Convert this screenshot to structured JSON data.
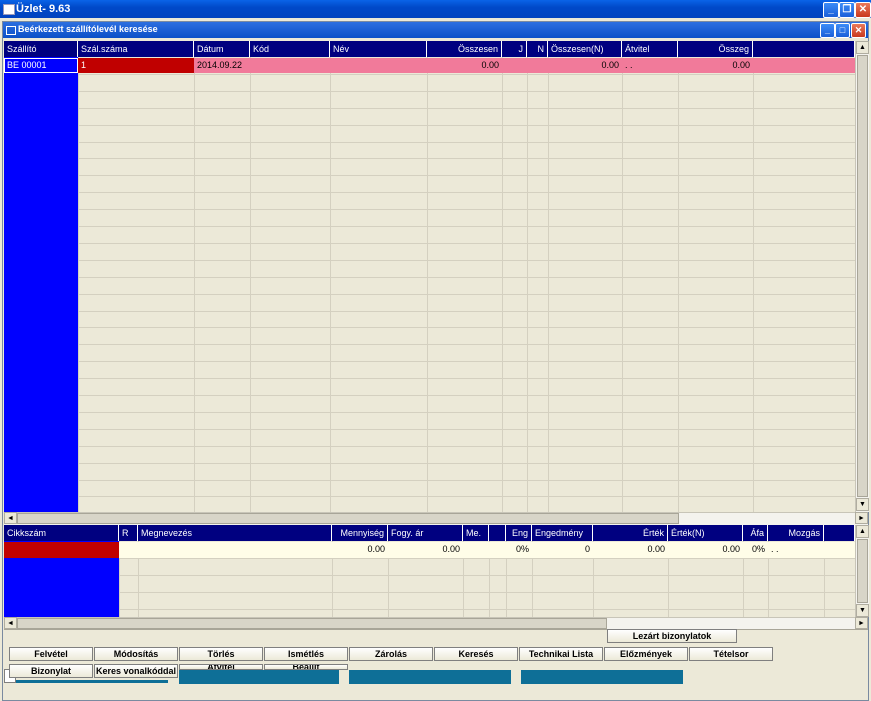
{
  "app": {
    "title": "Üzlet- 9.63"
  },
  "window": {
    "title": "Beérkezett szállítólevél keresése"
  },
  "top_grid": {
    "columns": [
      "Szállító",
      "Szál.száma",
      "Dátum",
      "Kód",
      "Név",
      "Összesen",
      "J",
      "N",
      "Összesen(N)",
      "Átvitel",
      "Összeg"
    ],
    "row": {
      "szallito": "BE  00001",
      "szal_szama": "1",
      "datum": "2014.09.22",
      "osszesen": "0.00",
      "osszesen_n": "0.00",
      "atvitel": ". .",
      "osszeg": "0.00"
    },
    "colors": {
      "selected_row": "#F17A9A",
      "selected_cell": "#C00000",
      "row_marker": "#0000FF",
      "header": "#000080"
    }
  },
  "bottom_grid": {
    "columns": [
      "Cikkszám",
      "R",
      "Megnevezés",
      "Mennyiség",
      "Fogy. ár",
      "Me.",
      "",
      "Eng",
      "Engedmény",
      "Érték",
      "Érték(N)",
      "Áfa",
      "Mozgás"
    ],
    "row": {
      "mennyiseg": "0.00",
      "fogy_ar": "0.00",
      "eng": "0%",
      "engedmeny": "0",
      "ertek": "0.00",
      "ertek_n": "0.00",
      "afa": "0%",
      "mozgas": ". ."
    }
  },
  "buttons": {
    "lezart": "Lezárt bizonylatok",
    "row1": [
      "Felvétel",
      "Módosítás",
      "Törlés",
      "Ismétlés",
      "Zárolás",
      "Keresés",
      "Technikai Lista",
      "Előzmények",
      "Tételsor"
    ],
    "row2": [
      "Bizonylat",
      "Keres vonalkóddal",
      "Átvitel",
      "Beállít"
    ]
  }
}
